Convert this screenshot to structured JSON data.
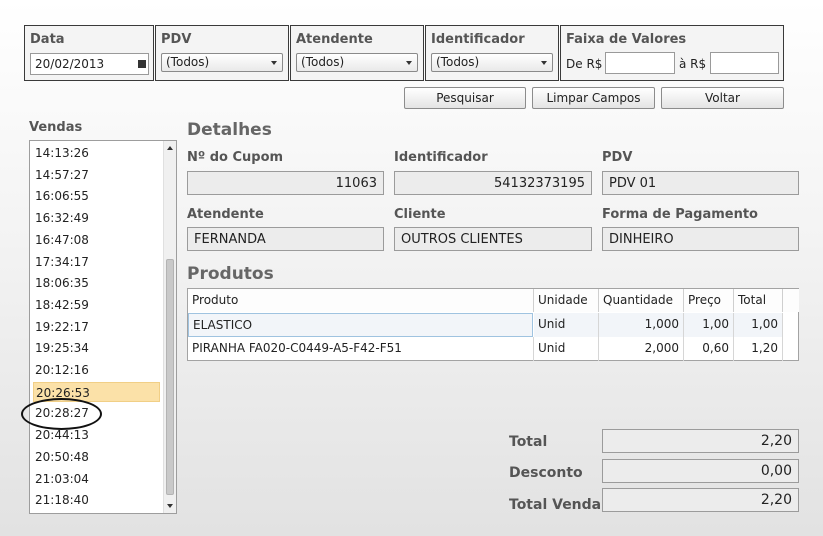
{
  "filters": {
    "data_label": "Data",
    "data_value": "20/02/2013",
    "pdv_label": "PDV",
    "pdv_value": "(Todos)",
    "atendente_label": "Atendente",
    "atendente_value": "(Todos)",
    "identificador_label": "Identificador",
    "identificador_value": "(Todos)",
    "faixa_label": "Faixa de Valores",
    "de_label": "De R$",
    "de_value": "",
    "ate_label": "à R$",
    "ate_value": ""
  },
  "buttons": {
    "pesquisar": "Pesquisar",
    "limpar": "Limpar Campos",
    "voltar": "Voltar"
  },
  "vendas": {
    "title": "Vendas",
    "items": [
      "14:13:26",
      "14:57:27",
      "16:06:55",
      "16:32:49",
      "16:47:08",
      "17:34:17",
      "18:06:35",
      "18:42:59",
      "19:22:17",
      "19:25:34",
      "20:12:16",
      "20:26:53",
      "20:28:27",
      "20:44:13",
      "20:50:48",
      "21:03:04",
      "21:18:40"
    ],
    "selected_index": 11
  },
  "detalhes": {
    "title": "Detalhes",
    "cupom_label": "Nº do Cupom",
    "cupom_value": "11063",
    "identificador_label": "Identificador",
    "identificador_value": "54132373195",
    "pdv_label": "PDV",
    "pdv_value": "PDV 01",
    "atendente_label": "Atendente",
    "atendente_value": "FERNANDA",
    "cliente_label": "Cliente",
    "cliente_value": "OUTROS CLIENTES",
    "pagamento_label": "Forma de Pagamento",
    "pagamento_value": "DINHEIRO"
  },
  "produtos": {
    "title": "Produtos",
    "columns": [
      "Produto",
      "Unidade",
      "Quantidade",
      "Preço",
      "Total"
    ],
    "rows": [
      [
        "ELASTICO",
        "Unid",
        "1,000",
        "1,00",
        "1,00"
      ],
      [
        "PIRANHA FA020-C0449-A5-F42-F51",
        "Unid",
        "2,000",
        "0,60",
        "1,20"
      ]
    ]
  },
  "totais": {
    "total_label": "Total",
    "total_value": "2,20",
    "desconto_label": "Desconto",
    "desconto_value": "0,00",
    "total_venda_label": "Total Venda",
    "total_venda_value": "2,20"
  }
}
